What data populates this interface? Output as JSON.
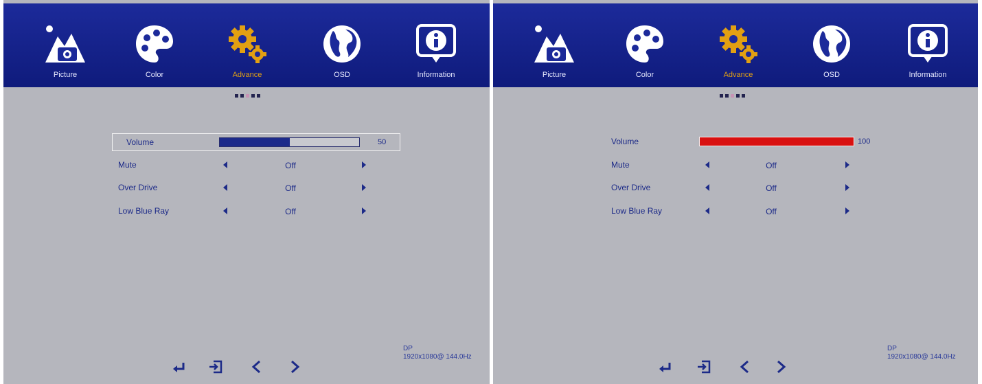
{
  "tabs": [
    {
      "label": "Picture",
      "icon": "picture-icon"
    },
    {
      "label": "Color",
      "icon": "palette-icon"
    },
    {
      "label": "Advance",
      "icon": "gear-icon"
    },
    {
      "label": "OSD",
      "icon": "globe-icon"
    },
    {
      "label": "Information",
      "icon": "info-icon"
    }
  ],
  "active_tab": "Advance",
  "colors": {
    "header": "#1c2a9a",
    "accent": "#e2a012",
    "text": "#1c2a88",
    "volume_left_fill": "#1c2a8a",
    "volume_right_fill": "#d81010"
  },
  "left": {
    "volume": {
      "label": "Volume",
      "value": "50",
      "level": 0.5
    },
    "items": [
      {
        "label": "Mute",
        "value": "Off"
      },
      {
        "label": "Over Drive",
        "value": "Off"
      },
      {
        "label": "Low Blue Ray",
        "value": "Off"
      }
    ],
    "signal": {
      "input": "DP",
      "mode": "1920x1080@ 144.0Hz"
    }
  },
  "right": {
    "volume": {
      "label": "Volume",
      "value": "100",
      "level": 1.0
    },
    "items": [
      {
        "label": "Mute",
        "value": "Off"
      },
      {
        "label": "Over Drive",
        "value": "Off"
      },
      {
        "label": "Low Blue Ray",
        "value": "Off"
      }
    ],
    "signal": {
      "input": "DP",
      "mode": "1920x1080@ 144.0Hz"
    }
  },
  "footer_buttons": [
    "enter-icon",
    "exit-icon",
    "left-icon",
    "right-icon"
  ]
}
